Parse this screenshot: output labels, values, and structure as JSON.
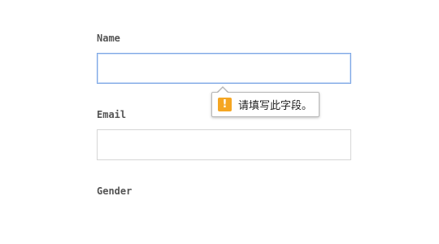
{
  "form": {
    "name_label": "Name",
    "name_value": "",
    "email_label": "Email",
    "email_value": "",
    "gender_label": "Gender"
  },
  "validation_tooltip": {
    "icon": "warning-icon",
    "icon_glyph": "!",
    "icon_color": "#f5a623",
    "message": "请填写此字段。"
  },
  "colors": {
    "focus_border": "#7ea7e5",
    "label_text": "#555555"
  }
}
